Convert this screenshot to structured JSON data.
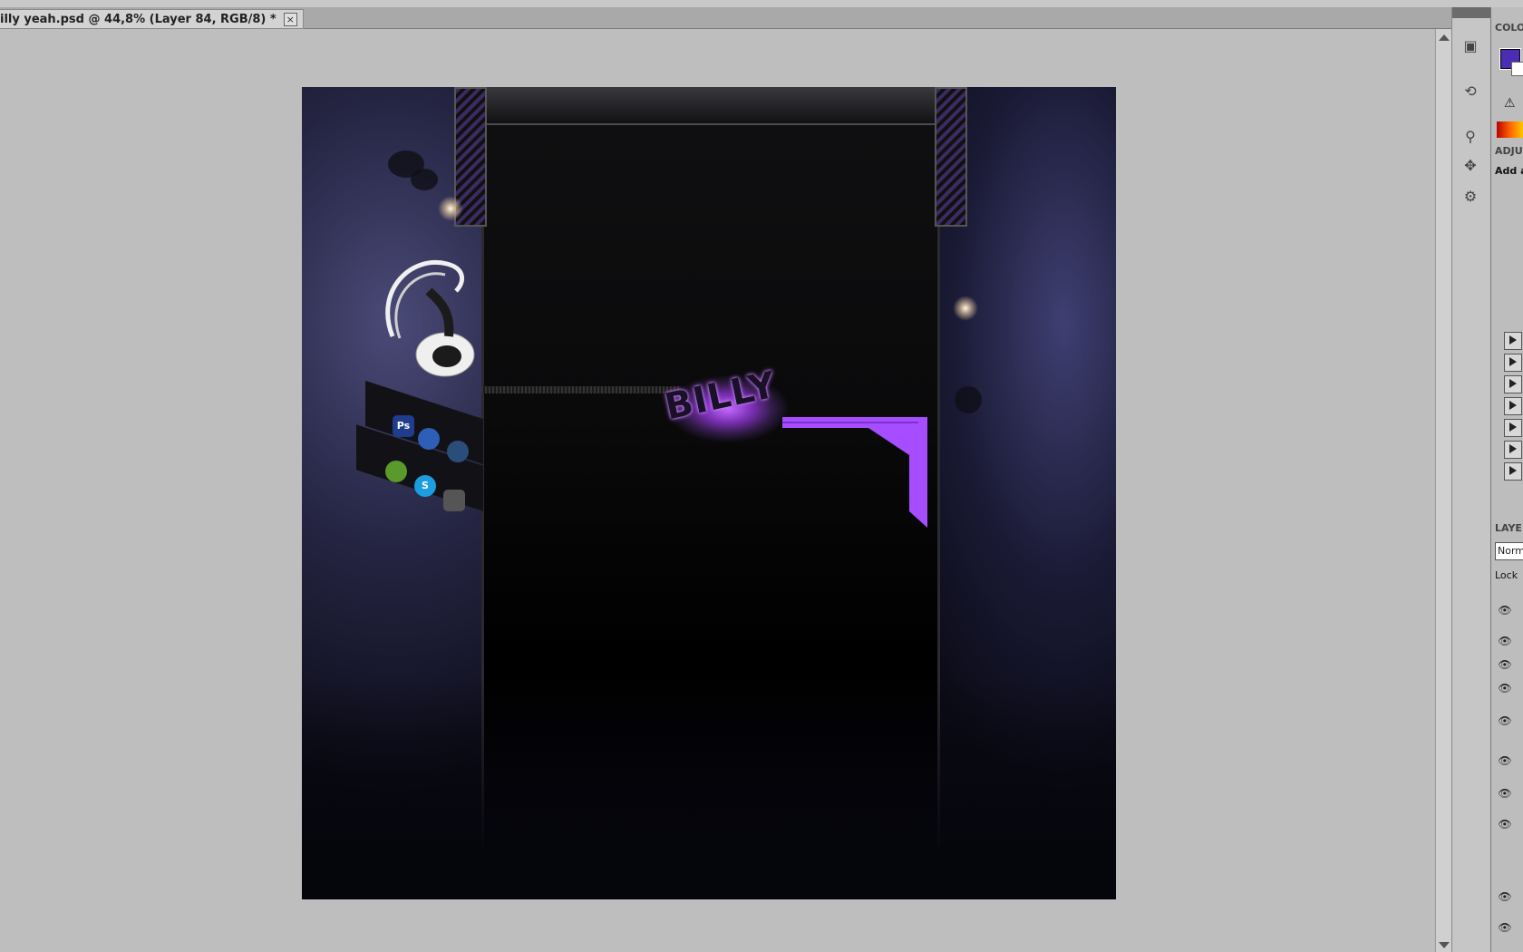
{
  "document_tab": {
    "title": "illy yeah.psd @ 44,8% (Layer 84, RGB/8) *",
    "close_symbol": "×"
  },
  "artwork": {
    "logo_text": "BILLY",
    "app_icons": [
      {
        "name": "photoshop-icon",
        "label": "Ps",
        "color": "#1f3d8c"
      },
      {
        "name": "firefox-icon",
        "label": "",
        "color": "#2e5fb8"
      },
      {
        "name": "messenger-icon",
        "label": "",
        "color": "#2a4d7a"
      },
      {
        "name": "spotify-icon",
        "label": "",
        "color": "#5a9a2a"
      },
      {
        "name": "skype-icon",
        "label": "S",
        "color": "#1c9de0"
      },
      {
        "name": "steam-icon",
        "label": "",
        "color": "#555555"
      }
    ]
  },
  "right_panels": {
    "color_title": "COLO",
    "adjustments_title": "ADJU",
    "adjustments_add": "Add a",
    "layers_title": "LAYE",
    "blend_mode": "Norm",
    "lock_label": "Lock"
  },
  "colors": {
    "foreground": "#4a2db0",
    "background": "#ffffff",
    "accent_purple": "#a64dff"
  }
}
